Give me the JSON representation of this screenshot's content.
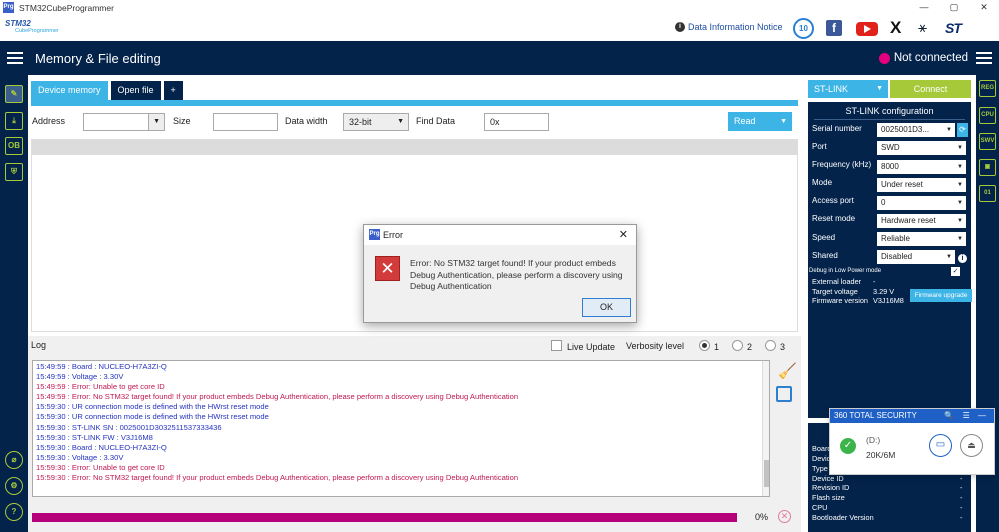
{
  "window": {
    "app_icon": "Prg",
    "title": "STM32CubeProgrammer",
    "controls": [
      "—",
      "▢",
      "✕"
    ]
  },
  "brand": {
    "logo_line1": "STM32",
    "logo_line2": "CubeProgrammer",
    "notice": "Data Information Notice",
    "anniversary": "10",
    "facebook": "f",
    "x": "X",
    "network": "⚹",
    "st": "ST"
  },
  "header": {
    "title": "Memory & File editing",
    "status": "Not connected",
    "status_color": "#e6007e"
  },
  "left_sidebar": [
    {
      "icon": "edit-icon",
      "glyph": "✎"
    },
    {
      "icon": "download-icon",
      "glyph": "⤓"
    },
    {
      "icon": "ob-icon",
      "glyph": "OB"
    },
    {
      "icon": "shield-icon",
      "glyph": "⛨"
    },
    {
      "icon": "stm-icon",
      "glyph": "⌀"
    },
    {
      "icon": "settings-icon",
      "glyph": "⚙"
    },
    {
      "icon": "help-icon",
      "glyph": "?"
    }
  ],
  "right_sidebar": [
    {
      "icon": "register-icon",
      "glyph": "REG"
    },
    {
      "icon": "cpu-icon",
      "glyph": "CPU"
    },
    {
      "icon": "swv-icon",
      "glyph": "SWV"
    },
    {
      "icon": "chip-icon",
      "glyph": "▣"
    },
    {
      "icon": "binary-icon",
      "glyph": "01"
    }
  ],
  "tabs": [
    "Device memory",
    "Open file",
    "+"
  ],
  "address_row": {
    "address_label": "Address",
    "address_value": "",
    "size_label": "Size",
    "size_value": "",
    "data_width_label": "Data width",
    "data_width_value": "32-bit",
    "find_label": "Find Data",
    "find_value": "0x",
    "read_button": "Read"
  },
  "log": {
    "title": "Log",
    "live_update": "Live Update",
    "verbosity_label": "Verbosity level",
    "levels": [
      "1",
      "2",
      "3"
    ],
    "selected_level": "1",
    "lines": [
      {
        "text": "15:49:59 : Board       : NUCLEO-H7A3ZI-Q",
        "type": "info"
      },
      {
        "text": "15:49:59 : Voltage     : 3.30V",
        "type": "info"
      },
      {
        "text": "15:49:59 : Error: Unable to get core ID",
        "type": "err"
      },
      {
        "text": "15:49:59 : Error: No STM32 target found! If your product embeds Debug Authentication, please perform a discovery using Debug Authentication",
        "type": "err"
      },
      {
        "text": "15:59:30 : UR connection mode is defined with the HWrst reset mode",
        "type": "info"
      },
      {
        "text": "15:59:30 : UR connection mode is defined with the HWrst reset mode",
        "type": "info"
      },
      {
        "text": "15:59:30 : ST-LINK SN  : 0025001D3032511537333436",
        "type": "info"
      },
      {
        "text": "15:59:30 : ST-LINK FW  : V3J16M8",
        "type": "info"
      },
      {
        "text": "15:59:30 : Board       : NUCLEO-H7A3ZI-Q",
        "type": "info"
      },
      {
        "text": "15:59:30 : Voltage     : 3.30V",
        "type": "info"
      },
      {
        "text": "15:59:30 : Error: Unable to get core ID",
        "type": "err"
      },
      {
        "text": "15:59:30 : Error: No STM32 target found! If your product embeds Debug Authentication, please perform a discovery using Debug Authentication",
        "type": "err"
      }
    ],
    "progress_pct": "0%",
    "progress_color": "#b6007a"
  },
  "stlink": {
    "selector": "ST-LINK",
    "connect": "Connect",
    "config_title": "ST-LINK configuration",
    "serial_label": "Serial number",
    "serial_value": "0025001D3...",
    "fields": [
      {
        "label": "Port",
        "value": "SWD"
      },
      {
        "label": "Frequency (kHz)",
        "value": "8000"
      },
      {
        "label": "Mode",
        "value": "Under reset"
      },
      {
        "label": "Access port",
        "value": "0"
      },
      {
        "label": "Reset mode",
        "value": "Hardware reset"
      },
      {
        "label": "Speed",
        "value": "Reliable"
      },
      {
        "label": "Shared",
        "value": "Disabled"
      }
    ],
    "low_power": "Debug in Low Power mode",
    "external_loader_label": "External loader",
    "external_loader_value": "-",
    "target_voltage_label": "Target voltage",
    "target_voltage_value": "3.29 V",
    "firmware_label": "Firmware version",
    "firmware_value": "V3J16M8",
    "firmware_upgrade": "Firmware upgrade"
  },
  "target_info": {
    "rows": [
      {
        "label": "Board",
        "value": "-"
      },
      {
        "label": "Device",
        "value": "-"
      },
      {
        "label": "Type",
        "value": "-"
      },
      {
        "label": "Device ID",
        "value": "-"
      },
      {
        "label": "Revision ID",
        "value": "-"
      },
      {
        "label": "Flash size",
        "value": "-"
      },
      {
        "label": "CPU",
        "value": "-"
      },
      {
        "label": "Bootloader Version",
        "value": "-"
      }
    ]
  },
  "dialog": {
    "icon": "Prg",
    "title": "Error",
    "message": "Error: No STM32 target found! If your product embeds Debug Authentication, please perform a discovery using Debug Authentication",
    "ok": "OK"
  },
  "security_popup": {
    "title": "360 TOTAL SECURITY",
    "controls": "🔍 ☰ —",
    "drive": "(D:)",
    "speed": "20K/6M"
  }
}
